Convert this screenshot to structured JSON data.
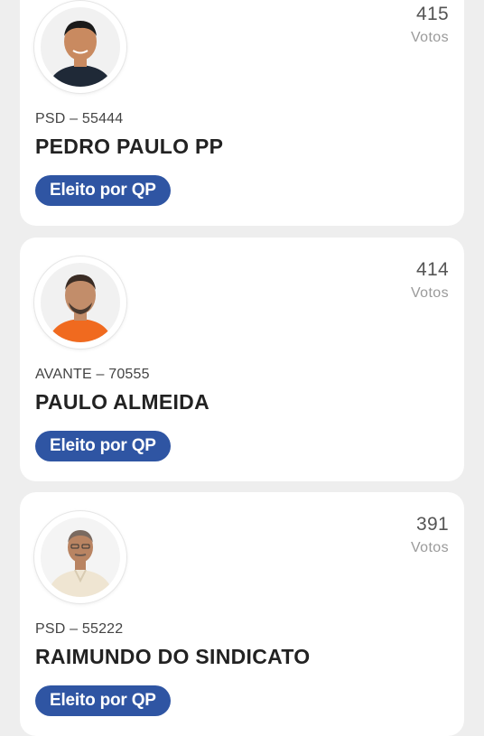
{
  "candidates": [
    {
      "votes": "415",
      "votes_label": "Votos",
      "party": "PSD – 55444",
      "name": "PEDRO PAULO PP",
      "status": "Eleito por QP",
      "shirt_color": "#1f2937",
      "skin_color": "#c98a60",
      "hair_color": "#1a1a1a"
    },
    {
      "votes": "414",
      "votes_label": "Votos",
      "party": "AVANTE – 70555",
      "name": "PAULO ALMEIDA",
      "status": "Eleito por QP",
      "shirt_color": "#f06a1f",
      "skin_color": "#c28d6a",
      "hair_color": "#3a2c24"
    },
    {
      "votes": "391",
      "votes_label": "Votos",
      "party": "PSD – 55222",
      "name": "RAIMUNDO DO SINDICATO",
      "status": "Eleito por QP",
      "shirt_color": "#efe5d2",
      "skin_color": "#b98462",
      "hair_color": "#7a6a60"
    }
  ],
  "colors": {
    "background": "#eeeeee",
    "card": "#ffffff",
    "badge": "#2f55a3"
  }
}
